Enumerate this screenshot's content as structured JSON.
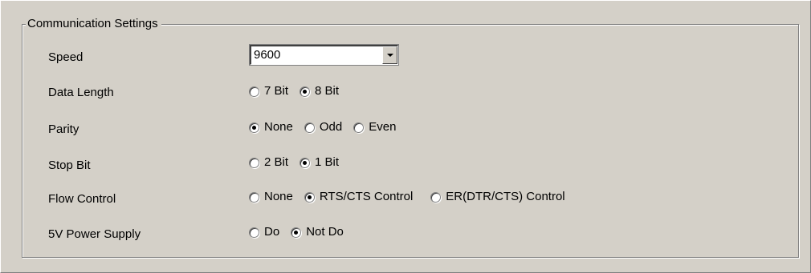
{
  "group": {
    "title": "Communication Settings"
  },
  "speed": {
    "label": "Speed",
    "value": "9600"
  },
  "data_length": {
    "label": "Data Length",
    "options": [
      {
        "label": "7 Bit",
        "checked": false
      },
      {
        "label": "8 Bit",
        "checked": true
      }
    ]
  },
  "parity": {
    "label": "Parity",
    "options": [
      {
        "label": "None",
        "checked": true
      },
      {
        "label": "Odd",
        "checked": false
      },
      {
        "label": "Even",
        "checked": false
      }
    ]
  },
  "stop_bit": {
    "label": "Stop Bit",
    "options": [
      {
        "label": "2 Bit",
        "checked": false
      },
      {
        "label": "1 Bit",
        "checked": true
      }
    ]
  },
  "flow_control": {
    "label": "Flow Control",
    "options": [
      {
        "label": "None",
        "checked": false
      },
      {
        "label": "RTS/CTS Control",
        "checked": true
      },
      {
        "label": "ER(DTR/CTS) Control",
        "checked": false
      }
    ]
  },
  "power_supply": {
    "label": "5V Power Supply",
    "options": [
      {
        "label": "Do",
        "checked": false
      },
      {
        "label": "Not Do",
        "checked": true
      }
    ]
  }
}
